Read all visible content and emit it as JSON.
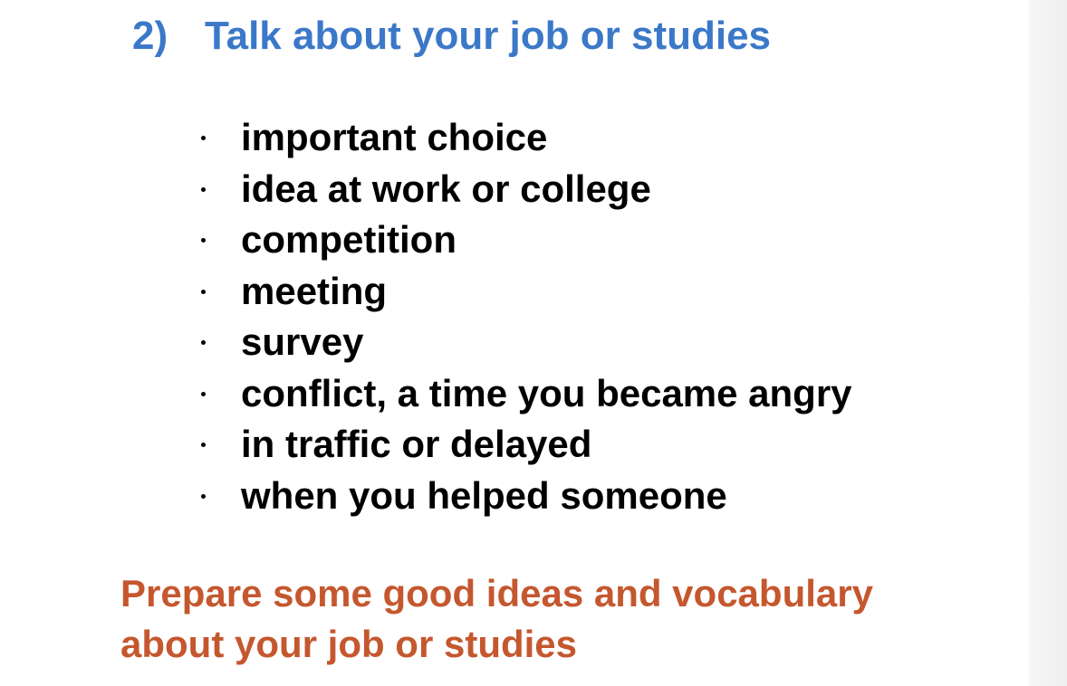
{
  "heading": {
    "number": "2)",
    "title": "Talk about your job or studies",
    "color": "#3b78c8"
  },
  "topics": [
    "important choice",
    "idea at work or college",
    "competition",
    "meeting",
    "survey",
    "conflict, a time you became angry",
    "in traffic or delayed",
    "when you helped someone"
  ],
  "note": {
    "line1": "Prepare some good ideas and vocabulary",
    "line2": "about your job or studies",
    "color": "#c5572e"
  }
}
